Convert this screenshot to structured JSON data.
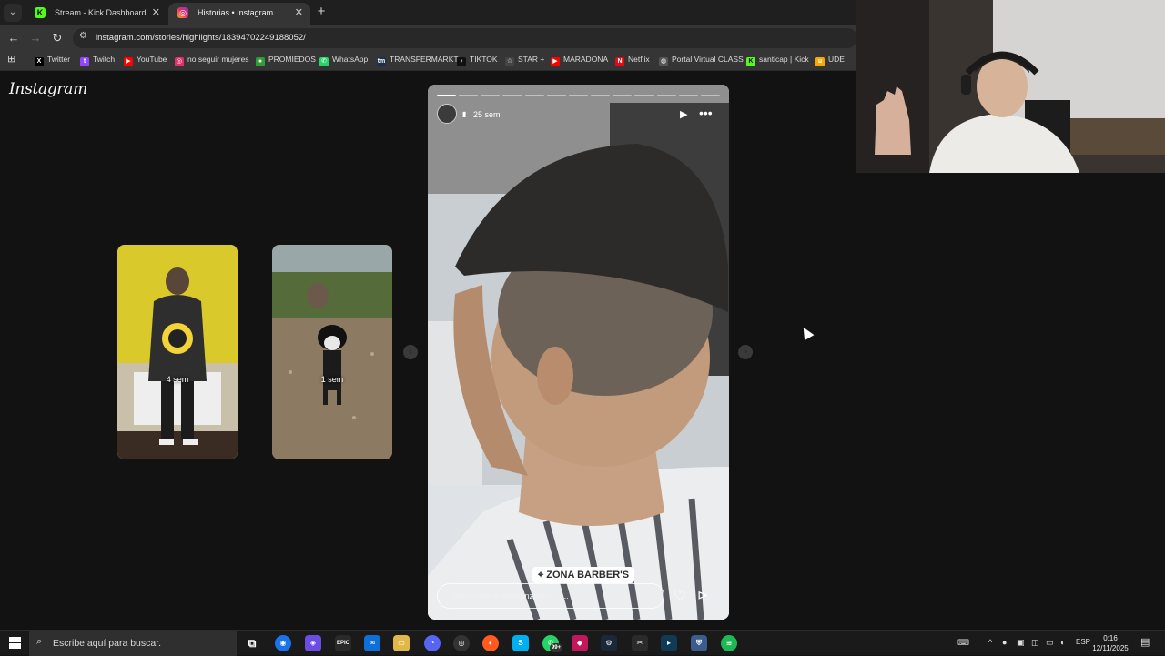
{
  "tabs": [
    {
      "title": "Stream - Kick Dashboard",
      "active": false,
      "favicon": "kick-icon",
      "color": "#53fc18"
    },
    {
      "title": "Historias • Instagram",
      "active": true,
      "favicon": "instagram-icon",
      "color": "#e1306c"
    }
  ],
  "address": {
    "url": "instagram.com/stories/highlights/18394702249188052/"
  },
  "bookmarks": [
    {
      "label": "Twitter",
      "icon": "x-icon",
      "color": "#000000"
    },
    {
      "label": "Twitch",
      "icon": "twitch-icon",
      "color": "#9146ff"
    },
    {
      "label": "YouTube",
      "icon": "youtube-icon",
      "color": "#ff0000"
    },
    {
      "label": "no seguir mujeres",
      "icon": "instagram-icon",
      "color": "#e1306c"
    },
    {
      "label": "PROMIEDOS",
      "icon": "promiedos-icon",
      "color": "#2e9d3a"
    },
    {
      "label": "WhatsApp",
      "icon": "whatsapp-icon",
      "color": "#25d366"
    },
    {
      "label": "TRANSFERMARKT",
      "icon": "transfermarkt-icon",
      "color": "#1a3151"
    },
    {
      "label": "TIKTOK",
      "icon": "tiktok-icon",
      "color": "#111111"
    },
    {
      "label": "STAR +",
      "icon": "star-icon",
      "color": "#444444"
    },
    {
      "label": "MARADONA",
      "icon": "youtube-icon",
      "color": "#ff0000"
    },
    {
      "label": "Netflix",
      "icon": "netflix-icon",
      "color": "#e50914"
    },
    {
      "label": "Portal Virtual CLASS",
      "icon": "globe-icon",
      "color": "#555555"
    },
    {
      "label": "santicap | Kick",
      "icon": "kick-icon",
      "color": "#53fc18"
    },
    {
      "label": "UDE",
      "icon": "ude-icon",
      "color": "#f7a800"
    }
  ],
  "page": {
    "logo": "Instagram",
    "thumbnails": [
      {
        "time": "4 sem"
      },
      {
        "time": "1 sem"
      }
    ],
    "story": {
      "time": "25 sem",
      "location": "ZONA BARBER'S",
      "reply_placeholder": "Responder a mattgonzalezz__...",
      "progress_segments": 13,
      "progress_done": 1
    }
  },
  "taskbar": {
    "search_placeholder": "Escribe aquí para buscar.",
    "language": "ESP",
    "time": "0:16",
    "date": "12/11/2025",
    "badge": "99+"
  }
}
